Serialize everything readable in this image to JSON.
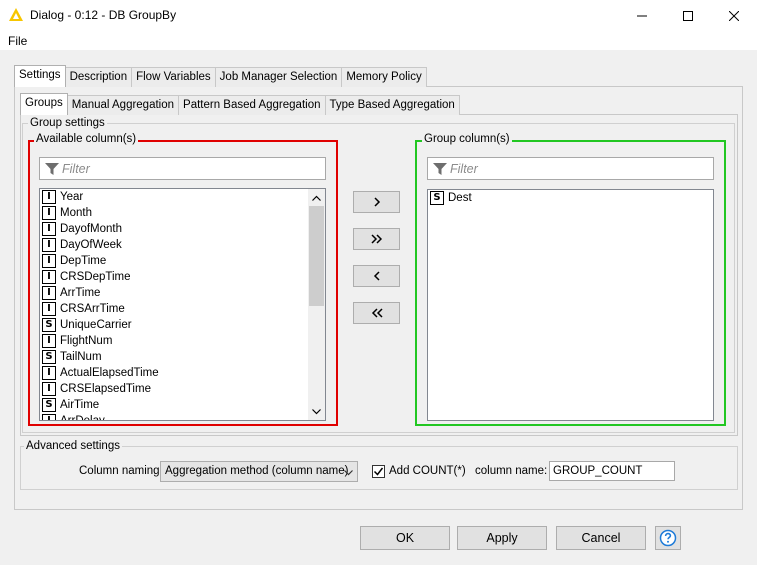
{
  "window": {
    "title": "Dialog - 0:12 - DB GroupBy",
    "menu": [
      "File"
    ]
  },
  "main_tabs": [
    {
      "label": "Settings",
      "active": true
    },
    {
      "label": "Description",
      "active": false
    },
    {
      "label": "Flow Variables",
      "active": false
    },
    {
      "label": "Job Manager Selection",
      "active": false
    },
    {
      "label": "Memory Policy",
      "active": false
    }
  ],
  "sub_tabs": [
    {
      "label": "Groups",
      "active": true
    },
    {
      "label": "Manual Aggregation",
      "active": false
    },
    {
      "label": "Pattern Based Aggregation",
      "active": false
    },
    {
      "label": "Type Based Aggregation",
      "active": false
    }
  ],
  "group_settings": {
    "legend": "Group settings",
    "available": {
      "legend": "Available column(s)",
      "filter_placeholder": "Filter",
      "columns": [
        {
          "type": "I",
          "name": "Year"
        },
        {
          "type": "I",
          "name": "Month"
        },
        {
          "type": "I",
          "name": "DayofMonth"
        },
        {
          "type": "I",
          "name": "DayOfWeek"
        },
        {
          "type": "I",
          "name": "DepTime"
        },
        {
          "type": "I",
          "name": "CRSDepTime"
        },
        {
          "type": "I",
          "name": "ArrTime"
        },
        {
          "type": "I",
          "name": "CRSArrTime"
        },
        {
          "type": "S",
          "name": "UniqueCarrier"
        },
        {
          "type": "I",
          "name": "FlightNum"
        },
        {
          "type": "S",
          "name": "TailNum"
        },
        {
          "type": "I",
          "name": "ActualElapsedTime"
        },
        {
          "type": "I",
          "name": "CRSElapsedTime"
        },
        {
          "type": "S",
          "name": "AirTime"
        },
        {
          "type": "I",
          "name": "ArrDelay"
        }
      ]
    },
    "group_columns": {
      "legend": "Group column(s)",
      "filter_placeholder": "Filter",
      "columns": [
        {
          "type": "S",
          "name": "Dest"
        }
      ]
    },
    "move_buttons": [
      {
        "name": "add-selected-button",
        "icon": "chevron-right-icon"
      },
      {
        "name": "add-all-button",
        "icon": "double-chevron-right-icon"
      },
      {
        "name": "remove-selected-button",
        "icon": "chevron-left-icon"
      },
      {
        "name": "remove-all-button",
        "icon": "double-chevron-left-icon"
      }
    ]
  },
  "advanced": {
    "legend": "Advanced settings",
    "column_naming_label": "Column naming:",
    "column_naming_value": "Aggregation method (column name)",
    "add_count_label": "Add COUNT(*)",
    "add_count_checked": true,
    "column_name_label": "column name:",
    "column_name_value": "GROUP_COUNT"
  },
  "buttons": {
    "ok": "OK",
    "apply": "Apply",
    "cancel": "Cancel"
  },
  "colors": {
    "available_border": "#e00000",
    "group_border": "#22c722"
  }
}
